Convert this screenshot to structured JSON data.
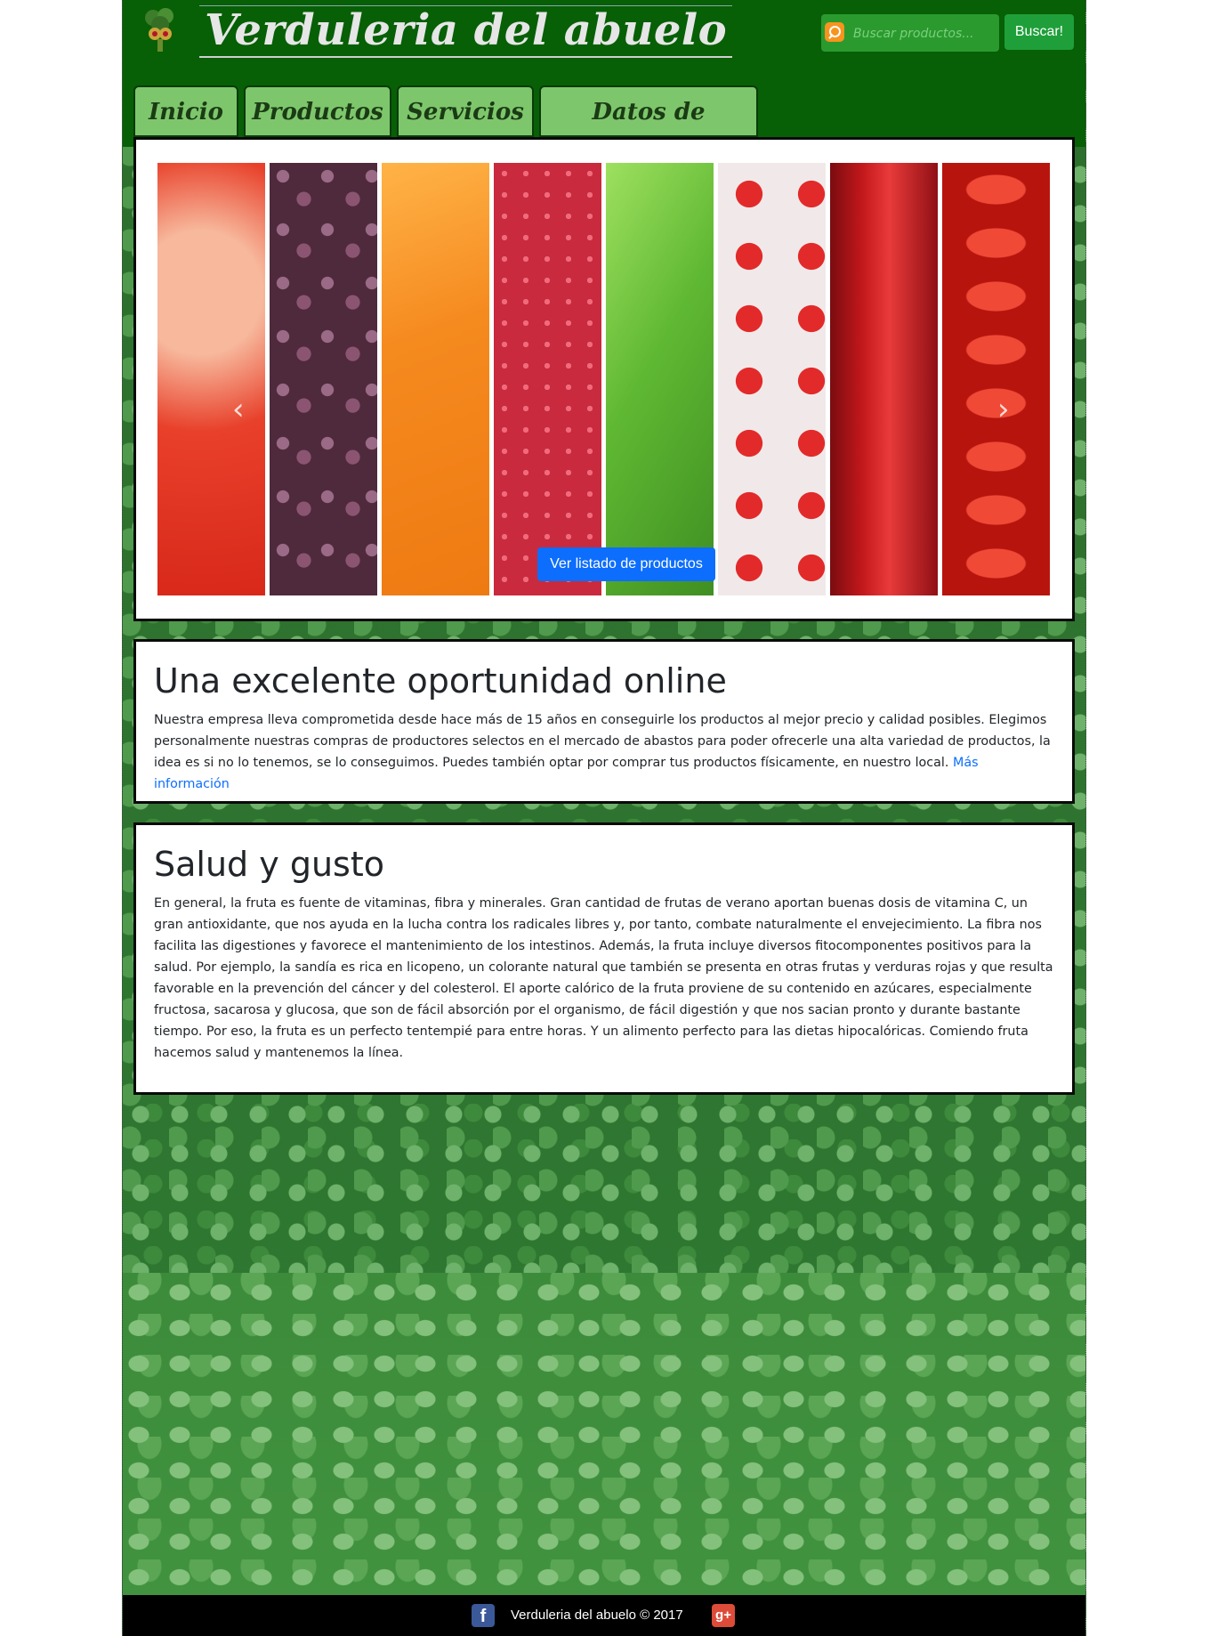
{
  "colors": {
    "header_bg": "#075f06",
    "tab_bg": "#7ec66c",
    "search_bg": "#2a9a2e",
    "button_bg": "#1f9f3a",
    "cta_bg": "#0d6efd",
    "footer_bg": "#000000"
  },
  "header": {
    "site_title": "Verduleria del abuelo",
    "logo_icon": "broccoli-logo-icon"
  },
  "search": {
    "icon": "search-icon",
    "placeholder": "Buscar productos...",
    "button_label": "Buscar!"
  },
  "nav": {
    "tabs": [
      {
        "label": "Inicio"
      },
      {
        "label": "Productos"
      },
      {
        "label": "Servicios"
      },
      {
        "label": "Datos de contacto"
      }
    ]
  },
  "carousel": {
    "cta_label": "Ver listado de productos",
    "prev_icon": "chevron-left-icon",
    "next_icon": "chevron-right-icon",
    "slide_count": 3,
    "active_slide": 1,
    "strip_colors": [
      "#e8402a",
      "#6e3d52",
      "#f58a1f",
      "#d63848",
      "#5fb832",
      "#c8161b",
      "#c3181c",
      "#e42a1b"
    ]
  },
  "sections": [
    {
      "title": "Una excelente oportunidad online",
      "body": "Nuestra empresa lleva comprometida desde hace más de 15 años en conseguirle los productos al mejor precio y calidad posibles. Elegimos personalmente nuestras compras de productores selectos en el mercado de abastos para poder ofrecerle una alta variedad de productos, la idea es si no lo tenemos, se lo conseguimos. Puedes también optar por comprar tus productos físicamente, en nuestro local.",
      "link_label": "Más información"
    },
    {
      "title": "Salud y gusto",
      "body": "En general, la fruta es fuente de vitaminas, fibra y minerales. Gran cantidad de frutas de verano aportan buenas dosis de vitamina C, un gran antioxidante, que nos ayuda en la lucha contra los radicales libres y, por tanto, combate naturalmente el envejecimiento. La fibra nos facilita las digestiones y favorece el mantenimiento de los intestinos. Además, la fruta incluye diversos fitocomponentes positivos para la salud. Por ejemplo, la sandía es rica en licopeno, un colorante natural que también se presenta en otras frutas y verduras rojas y que resulta favorable en la prevención del cáncer y del colesterol. El aporte calórico de la fruta proviene de su contenido en azúcares, especialmente fructosa, sacarosa y glucosa, que son de fácil absorción por el organismo, de fácil digestión y que nos sacian pronto y durante bastante tiempo. Por eso, la fruta es un perfecto tentempié para entre horas. Y un alimento perfecto para las dietas hipocalóricas. Comiendo fruta hacemos salud y mantenemos la línea."
    }
  ],
  "footer": {
    "text": "Verduleria del abuelo © 2017",
    "facebook_glyph": "f",
    "gplus_glyph": "g+"
  }
}
